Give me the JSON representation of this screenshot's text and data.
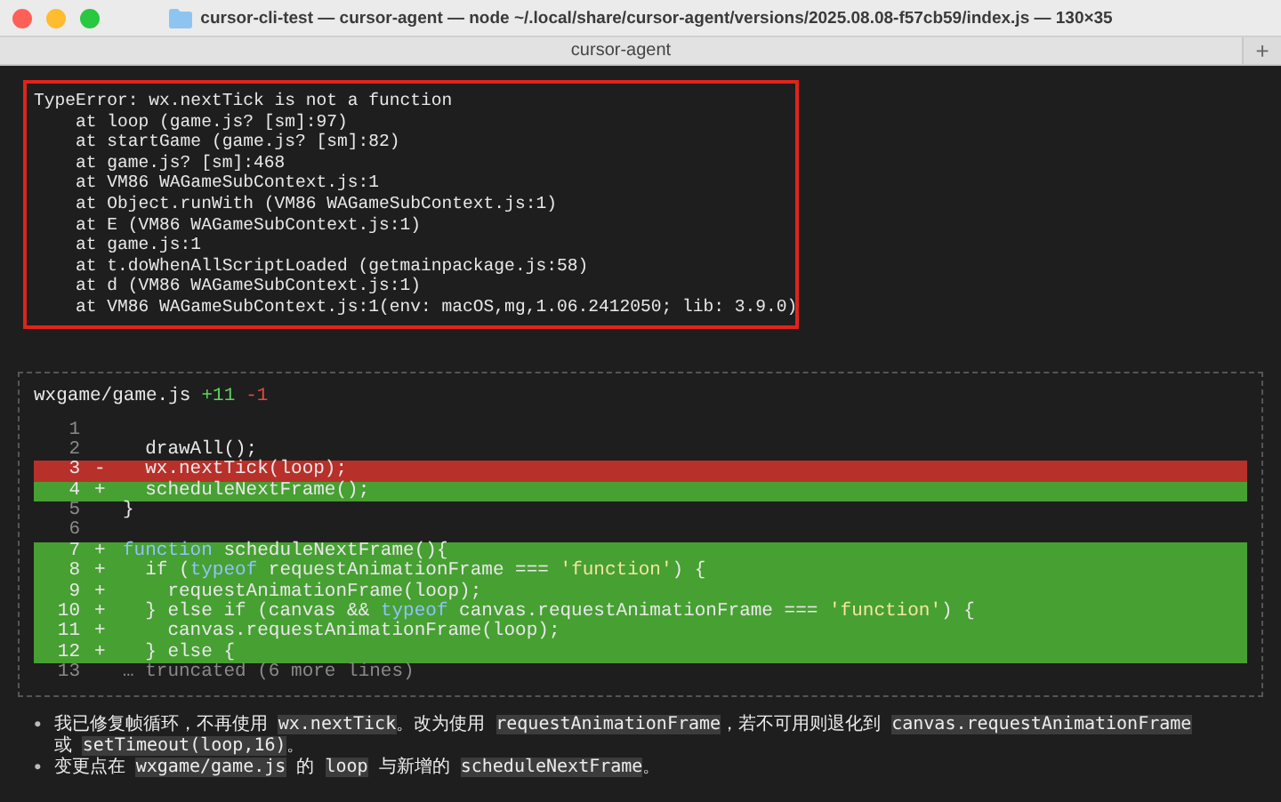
{
  "window": {
    "title": "cursor-cli-test — cursor-agent — node ~/.local/share/cursor-agent/versions/2025.08.08-f57cb59/index.js — 130×35",
    "tab": "cursor-agent",
    "new_tab": "+"
  },
  "error": {
    "lines": [
      "TypeError: wx.nextTick is not a function",
      "    at loop (game.js? [sm]:97)",
      "    at startGame (game.js? [sm]:82)",
      "    at game.js? [sm]:468",
      "    at VM86 WAGameSubContext.js:1",
      "    at Object.runWith (VM86 WAGameSubContext.js:1)",
      "    at E (VM86 WAGameSubContext.js:1)",
      "    at game.js:1",
      "    at t.doWhenAllScriptLoaded (getmainpackage.js:58)",
      "    at d (VM86 WAGameSubContext.js:1)",
      "    at VM86 WAGameSubContext.js:1(env: macOS,mg,1.06.2412050; lib: 3.9.0)"
    ]
  },
  "diff": {
    "file": "wxgame/game.js",
    "added": "+11",
    "removed": "-1",
    "lines": [
      {
        "number": "1",
        "kind": "context"
      },
      {
        "number": "2",
        "kind": "context",
        "segments": [
          {
            "text": "  drawAll();",
            "kind": "plain"
          }
        ]
      },
      {
        "number": "3",
        "kind": "removed",
        "sign": "-",
        "segments": [
          {
            "text": "  wx.nextTick(loop);",
            "kind": "plain"
          }
        ]
      },
      {
        "number": "4",
        "kind": "added",
        "sign": "+",
        "segments": [
          {
            "text": "  scheduleNextFrame();",
            "kind": "plain"
          }
        ]
      },
      {
        "number": "5",
        "kind": "context",
        "segments": [
          {
            "text": "}",
            "kind": "plain"
          }
        ]
      },
      {
        "number": "6",
        "kind": "context"
      },
      {
        "number": "7",
        "kind": "added",
        "sign": "+",
        "segments": [
          {
            "text": "function",
            "kind": "keyword"
          },
          {
            "text": " scheduleNextFrame(){",
            "kind": "plain"
          }
        ]
      },
      {
        "number": "8",
        "kind": "added",
        "sign": "+",
        "segments": [
          {
            "text": "  if (",
            "kind": "plain"
          },
          {
            "text": "typeof",
            "kind": "keyword"
          },
          {
            "text": " requestAnimationFrame === ",
            "kind": "plain"
          },
          {
            "text": "'function'",
            "kind": "string"
          },
          {
            "text": ") {",
            "kind": "plain"
          }
        ]
      },
      {
        "number": "9",
        "kind": "added",
        "sign": "+",
        "segments": [
          {
            "text": "    requestAnimationFrame(loop);",
            "kind": "plain"
          }
        ]
      },
      {
        "number": "10",
        "kind": "added",
        "sign": "+",
        "segments": [
          {
            "text": "  } else if (canvas && ",
            "kind": "plain"
          },
          {
            "text": "typeof",
            "kind": "keyword"
          },
          {
            "text": " canvas.requestAnimationFrame === ",
            "kind": "plain"
          },
          {
            "text": "'function'",
            "kind": "string"
          },
          {
            "text": ") {",
            "kind": "plain"
          }
        ]
      },
      {
        "number": "11",
        "kind": "added",
        "sign": "+",
        "segments": [
          {
            "text": "    canvas.requestAnimationFrame(loop);",
            "kind": "plain"
          }
        ]
      },
      {
        "number": "12",
        "kind": "added",
        "sign": "+",
        "segments": [
          {
            "text": "  } else {",
            "kind": "plain"
          }
        ]
      },
      {
        "number": "13",
        "kind": "truncated",
        "segments": [
          {
            "text": "… truncated (6 more lines)",
            "kind": "plain"
          }
        ]
      }
    ]
  },
  "summary": [
    {
      "bullet": "•",
      "parts": [
        {
          "text": "我已修复帧循环，不再使用 ",
          "code": false
        },
        {
          "text": "wx.nextTick",
          "code": true
        },
        {
          "text": "。改为使用 ",
          "code": false
        },
        {
          "text": "requestAnimationFrame",
          "code": true
        },
        {
          "text": "，若不可用则退化到 ",
          "code": false
        },
        {
          "text": "canvas.requestAnimationFrame",
          "code": true
        },
        {
          "text": " 或 ",
          "code": false
        },
        {
          "text": "setTimeout(loop,16)",
          "code": true
        },
        {
          "text": "。",
          "code": false
        }
      ]
    },
    {
      "bullet": "•",
      "parts": [
        {
          "text": "变更点在 ",
          "code": false
        },
        {
          "text": "wxgame/game.js",
          "code": true
        },
        {
          "text": " 的 ",
          "code": false
        },
        {
          "text": "loop",
          "code": true
        },
        {
          "text": " 与新增的 ",
          "code": false
        },
        {
          "text": "scheduleNextFrame",
          "code": true
        },
        {
          "text": "。",
          "code": false
        }
      ]
    }
  ]
}
